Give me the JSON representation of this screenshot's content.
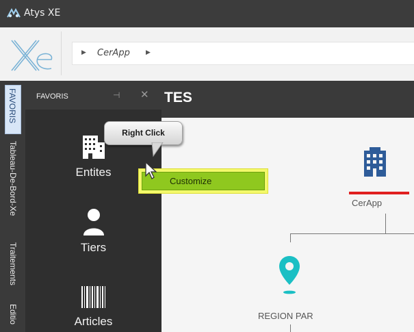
{
  "window": {
    "title": "Atys XE"
  },
  "ribbon": {
    "breadcrumb": [
      "CerApp"
    ]
  },
  "side_tabs": [
    {
      "label": "FAVORIS",
      "active": true
    },
    {
      "label": "Tableau-De-Bord-Xe",
      "active": false
    },
    {
      "label": "Traitements",
      "active": false
    },
    {
      "label": "Editio",
      "active": false
    }
  ],
  "favoris_panel": {
    "title": "FAVORIS",
    "pin_icon": "pin-icon",
    "close_icon": "close-icon",
    "items": [
      {
        "label": "Entites",
        "icon": "building-icon"
      },
      {
        "label": "Tiers",
        "icon": "person-icon"
      },
      {
        "label": "Articles",
        "icon": "barcode-icon"
      }
    ]
  },
  "main": {
    "title": "TES",
    "org_chart": {
      "root": {
        "label": "CerApp",
        "icon": "building-icon",
        "underline_color": "#e02020"
      },
      "child": {
        "label": "REGION PAR",
        "icon": "map-pin-icon",
        "icon_color": "#1bbfc4"
      }
    }
  },
  "annotation": {
    "callout": "Right Click",
    "context_menu_item": "Customize",
    "highlight_color": "#f3f96b",
    "menu_item_color": "#8fc81f"
  }
}
